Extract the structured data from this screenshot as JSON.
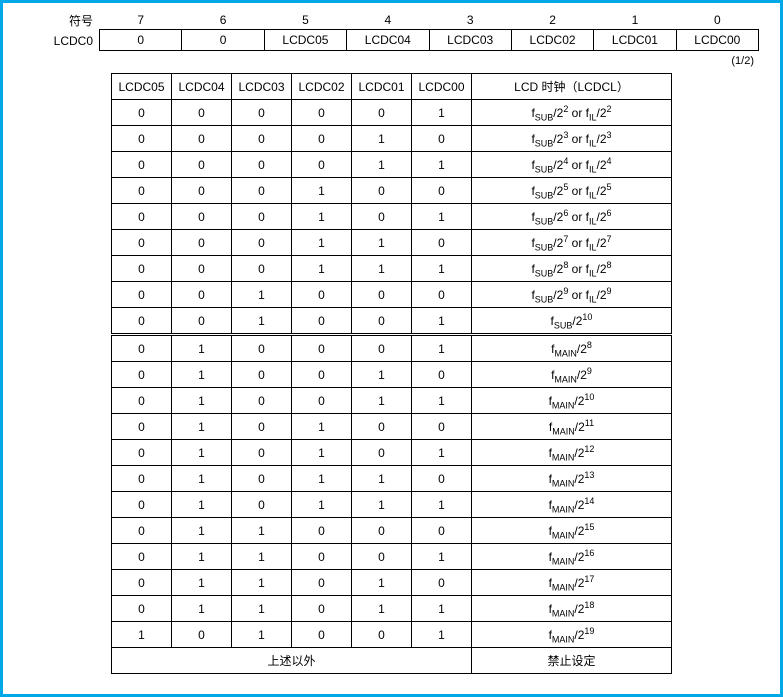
{
  "header": {
    "symbol_label": "符号",
    "register_label": "LCDC0",
    "bit_numbers": [
      "7",
      "6",
      "5",
      "4",
      "3",
      "2",
      "1",
      "0"
    ],
    "bit_names": [
      "0",
      "0",
      "LCDC05",
      "LCDC04",
      "LCDC03",
      "LCDC02",
      "LCDC01",
      "LCDC00"
    ]
  },
  "page_indicator": "(1/2)",
  "main": {
    "columns": [
      "LCDC05",
      "LCDC04",
      "LCDC03",
      "LCDC02",
      "LCDC01",
      "LCDC00"
    ],
    "clock_header": "LCD 时钟（LCDCL）",
    "group1": [
      {
        "b": [
          "0",
          "0",
          "0",
          "0",
          "0",
          "1"
        ],
        "clk": {
          "t": "sub_or_il",
          "n": "2"
        }
      },
      {
        "b": [
          "0",
          "0",
          "0",
          "0",
          "1",
          "0"
        ],
        "clk": {
          "t": "sub_or_il",
          "n": "3"
        }
      },
      {
        "b": [
          "0",
          "0",
          "0",
          "0",
          "1",
          "1"
        ],
        "clk": {
          "t": "sub_or_il",
          "n": "4"
        }
      },
      {
        "b": [
          "0",
          "0",
          "0",
          "1",
          "0",
          "0"
        ],
        "clk": {
          "t": "sub_or_il",
          "n": "5"
        }
      },
      {
        "b": [
          "0",
          "0",
          "0",
          "1",
          "0",
          "1"
        ],
        "clk": {
          "t": "sub_or_il",
          "n": "6"
        }
      },
      {
        "b": [
          "0",
          "0",
          "0",
          "1",
          "1",
          "0"
        ],
        "clk": {
          "t": "sub_or_il",
          "n": "7"
        }
      },
      {
        "b": [
          "0",
          "0",
          "0",
          "1",
          "1",
          "1"
        ],
        "clk": {
          "t": "sub_or_il",
          "n": "8"
        }
      },
      {
        "b": [
          "0",
          "0",
          "1",
          "0",
          "0",
          "0"
        ],
        "clk": {
          "t": "sub_or_il",
          "n": "9"
        }
      },
      {
        "b": [
          "0",
          "0",
          "1",
          "0",
          "0",
          "1"
        ],
        "clk": {
          "t": "sub",
          "n": "10"
        }
      }
    ],
    "group2": [
      {
        "b": [
          "0",
          "1",
          "0",
          "0",
          "0",
          "1"
        ],
        "clk": {
          "t": "main",
          "n": "8"
        }
      },
      {
        "b": [
          "0",
          "1",
          "0",
          "0",
          "1",
          "0"
        ],
        "clk": {
          "t": "main",
          "n": "9"
        }
      },
      {
        "b": [
          "0",
          "1",
          "0",
          "0",
          "1",
          "1"
        ],
        "clk": {
          "t": "main",
          "n": "10"
        }
      },
      {
        "b": [
          "0",
          "1",
          "0",
          "1",
          "0",
          "0"
        ],
        "clk": {
          "t": "main",
          "n": "11"
        }
      },
      {
        "b": [
          "0",
          "1",
          "0",
          "1",
          "0",
          "1"
        ],
        "clk": {
          "t": "main",
          "n": "12"
        }
      },
      {
        "b": [
          "0",
          "1",
          "0",
          "1",
          "1",
          "0"
        ],
        "clk": {
          "t": "main",
          "n": "13"
        }
      },
      {
        "b": [
          "0",
          "1",
          "0",
          "1",
          "1",
          "1"
        ],
        "clk": {
          "t": "main",
          "n": "14"
        }
      },
      {
        "b": [
          "0",
          "1",
          "1",
          "0",
          "0",
          "0"
        ],
        "clk": {
          "t": "main",
          "n": "15"
        }
      },
      {
        "b": [
          "0",
          "1",
          "1",
          "0",
          "0",
          "1"
        ],
        "clk": {
          "t": "main",
          "n": "16"
        }
      },
      {
        "b": [
          "0",
          "1",
          "1",
          "0",
          "1",
          "0"
        ],
        "clk": {
          "t": "main",
          "n": "17"
        }
      },
      {
        "b": [
          "0",
          "1",
          "1",
          "0",
          "1",
          "1"
        ],
        "clk": {
          "t": "main",
          "n": "18"
        }
      },
      {
        "b": [
          "1",
          "0",
          "1",
          "0",
          "0",
          "1"
        ],
        "clk": {
          "t": "main",
          "n": "19"
        }
      }
    ],
    "footer": {
      "other_label": "上述以外",
      "forbidden_label": "禁止设定"
    }
  }
}
